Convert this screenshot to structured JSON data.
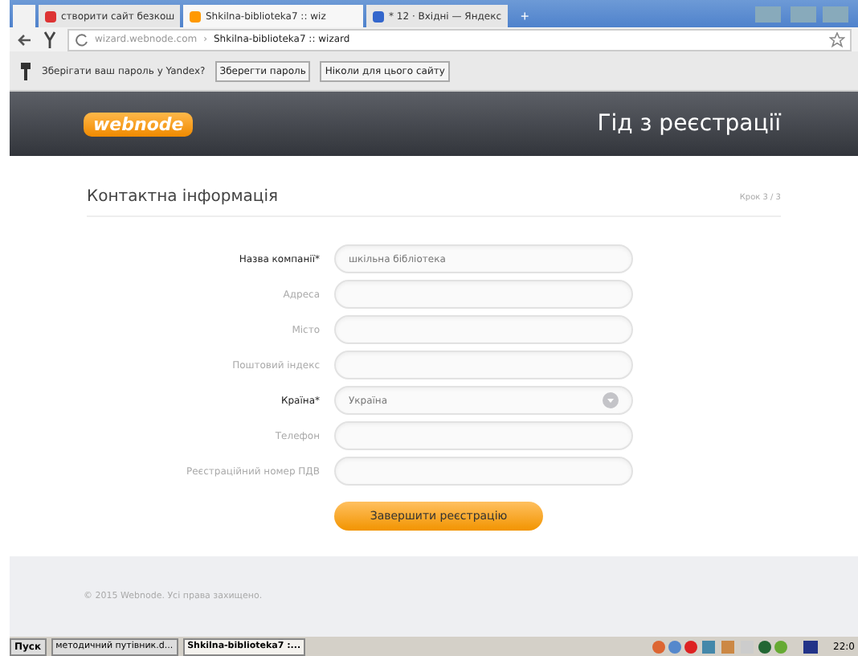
{
  "browser": {
    "tabs": [
      {
        "label": "створити сайт безкош",
        "selected": false,
        "kind": "red"
      },
      {
        "label": "Shkilna-biblioteka7 :: wiz",
        "selected": true,
        "kind": "orange"
      },
      {
        "label": "* 12 · Вхідні — Яндекс",
        "selected": false,
        "kind": "mail"
      }
    ],
    "new_tab": "+",
    "address_host": "wizard.webnode.com",
    "address_sep": "›",
    "address_title": "Shkilna-biblioteka7 :: wizard",
    "password_prompt": "Зберігати ваш пароль у Yandex?",
    "password_buttons": [
      "Зберегти пароль",
      "Ніколи для цього сайту"
    ]
  },
  "header": {
    "logo": "webnode",
    "title": "Гід з реєстрації"
  },
  "section": {
    "title": "Контактна інформація",
    "step": "Крок 3 / 3"
  },
  "form": {
    "fields": [
      {
        "label": "Назва компанії*",
        "required": true,
        "kind": "text",
        "value": "шкільна бібліотека"
      },
      {
        "label": "Адреса",
        "required": false,
        "kind": "text"
      },
      {
        "label": "Місто",
        "required": false,
        "kind": "text"
      },
      {
        "label": "Поштовий індекс",
        "required": false,
        "kind": "text"
      },
      {
        "label": "Країна*",
        "required": true,
        "kind": "select",
        "value": "Україна"
      },
      {
        "label": "Телефон",
        "required": false,
        "kind": "text"
      },
      {
        "label": "Реєстраційний номер ПДВ",
        "required": false,
        "kind": "text"
      }
    ],
    "submit": "Завершити реєстрацію"
  },
  "footer": {
    "copyright": "© 2015 Webnode. Усі права захищено."
  },
  "taskbar": {
    "start": "Пуск",
    "items": [
      {
        "label": "методичний путівник.d...",
        "selected": false
      },
      {
        "label": "Shkilna-biblioteka7 :...",
        "selected": true
      }
    ],
    "clock": "22:0"
  }
}
